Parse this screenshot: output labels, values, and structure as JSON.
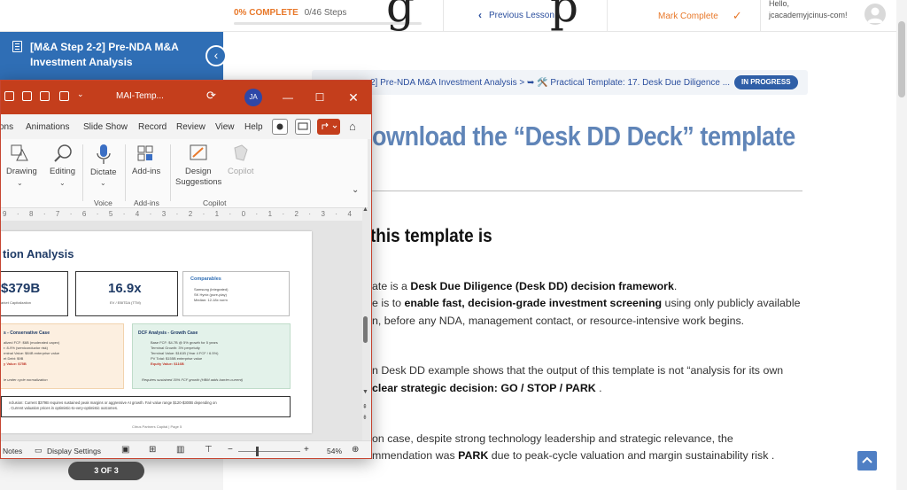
{
  "topbar": {
    "progress_pct": "0% COMPLETE",
    "progress_steps": "0/46 Steps",
    "progress_fraction": 0,
    "prev_lesson": "Previous Lesson",
    "mark_complete": "Mark Complete",
    "hello": "Hello,",
    "user_email": "jcacademyjcinus-com!"
  },
  "sidebar": {
    "title": "[M&A Step 2-2] Pre-NDA M&A Investment Analysis"
  },
  "lesson": {
    "breadcrumb": "2] Pre-NDA M&A Investment Analysis > ➥ 🛠️ Practical Template: 17. Desk Due Diligence ...",
    "badge": "IN PROGRESS",
    "h1": "ownload the “Desk DD Deck” template",
    "h2": "this template is",
    "p1_pre": "ate is a ",
    "p1_bold": "Desk Due Diligence (Desk DD) decision framework",
    "p1_post": ".",
    "p2_pre": "e is to ",
    "p2_bold": "enable fast, decision-grade investment screening",
    "p2_post": " using only publicly available",
    "p3": "n, before any NDA, management contact, or resource-intensive work begins.",
    "p4": "n Desk DD example shows that the output of this template is not “analysis for its own",
    "p5_bold": "clear strategic decision",
    "p5_mid": ": GO / STOP / PARK",
    "p5_post": " .",
    "p6": "on case, despite strong technology leadership and strategic relevance, the",
    "p7_pre": "mmendation was ",
    "p7_bold": "PARK",
    "p7_post": " due to peak-cycle valuation and margin sustainability risk ."
  },
  "ppt": {
    "filename": "MAI-Temp...",
    "user_initials": "JA",
    "tabs": [
      "ons",
      "Animations",
      "Slide Show",
      "Record",
      "Review",
      "View",
      "Help"
    ],
    "ribbon": {
      "drawing": "Drawing",
      "editing": "Editing",
      "dictate": "Dictate",
      "addins": "Add-ins",
      "design_1": "Design",
      "design_2": "Suggestions",
      "copilot": "Copilot",
      "group_voice": "Voice",
      "group_addins": "Add-ins",
      "group_copilot": "Copilot"
    },
    "ruler": "9 · 8 · 7 · 6 · 5 · 4 · 3 · 2 · 1 · 0 · 1 · 2 · 3 · 4 · 5 · 6 · 7 · 8 · 9 · 10 · 11 · 12",
    "slide": {
      "title": "tion Analysis",
      "kpi1_value": "$379B",
      "kpi1_label": "arket Capitalization",
      "kpi2_value": "16.9x",
      "kpi2_label": "EV / EBITDA (TTM)",
      "comparables_title": "Comparables",
      "comparables": [
        "Samsung (integrated)",
        "SK Hynix (pure-play)",
        "Median: 12-18x norm"
      ],
      "conservative_title": "s - Conservative Case",
      "conservative_lines": [
        "alized FCF: $6B (moderated capex)",
        "r: 8-9% (semiconductor risk)",
        "rminal Value: $84B enterprise value",
        "et Debt: $9B",
        "y Value: $75B"
      ],
      "conservative_note": "ie under cycle normalization",
      "growth_title": "DCF Analysis - Growth Case",
      "growth_lines": [
        "Base FCF: $4.7B @ 5% growth for 5 years",
        "Terminal Growth: 3% perpetuity",
        "Terminal Value: $161B (Year 4 FCF / 6.5%)",
        "PV Total: $155B enterprise value",
        "Equity Value: $116B"
      ],
      "growth_note": "Requires sustained 30% FCF growth (HBM adds barrier-current)",
      "conclusion_1": "nclusion: Current $379B requires sustained peak margins or aggressive AI growth. Fair value range $120-$300B depending on",
      "conclusion_2": ". Current valuation prices in optimistic-to-very-optimistic outcomes.",
      "footer": "Citrus Partners Capital | Page 5"
    },
    "status": {
      "notes": "Notes",
      "display": "Display Settings",
      "zoom": "54%"
    }
  },
  "page_indicator": "3 OF 3",
  "colors": {
    "accent_orange": "#e8782a",
    "sidebar_blue": "#2f6eb5",
    "ppt_red": "#c43e1c",
    "heading_blue": "#6085b8"
  }
}
